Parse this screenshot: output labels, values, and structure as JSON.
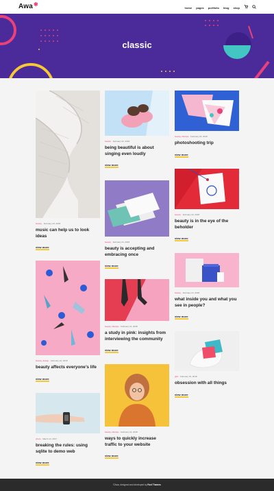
{
  "header": {
    "logo": "Awa",
    "nav": [
      "home",
      "pages",
      "portfolio",
      "blog",
      "shop"
    ],
    "cart_icon": "cart-icon",
    "search_icon": "search-icon"
  },
  "hero": {
    "title": "classic",
    "background": "#4b2a9a"
  },
  "accent": {
    "pink": "#e9427a",
    "yellow": "#f6c736"
  },
  "read_more": "view more",
  "posts": {
    "c1a": {
      "category": "beauty",
      "date": "February 23, 2018",
      "title": "music can help us to look ideas"
    },
    "c1b": {
      "category": "beauty, design",
      "date": "February 22, 2018",
      "title": "beauty affects everyone’s life"
    },
    "c1c": {
      "category": "photo",
      "date": "March 13, 2017",
      "title": "breaking the rules: using sqlite to demo web"
    },
    "c2a": {
      "category": "beauty",
      "date": "February 22, 2018",
      "title": "being beautiful is about singing even loudly"
    },
    "c2b": {
      "category": "beauty",
      "date": "February 21, 2018",
      "title": "beauty is accepting and embracing once"
    },
    "c2c": {
      "category": "beauty, lifestyle",
      "date": "February 21, 2018",
      "title": "a study in pink: insights from interviewing the community"
    },
    "c2d": {
      "category": "beauty, lifestyle",
      "date": "February 19, 2018",
      "title": "ways to quickly increase traffic to your website"
    },
    "c3a": {
      "category": "beauty, lifestyle",
      "date": "February 23, 2018",
      "title": "photoshooting trip"
    },
    "c3b": {
      "category": "beauty",
      "date": "February 22, 2018",
      "title": "beauty is in the eye of the beholder"
    },
    "c3c": {
      "category": "beauty",
      "date": "February 21, 2018",
      "title": "what inside you and what you see in people?"
    },
    "c3d": {
      "category": "glitz",
      "date": "February 19, 2018",
      "title": "obsession with all things"
    }
  },
  "footer": {
    "prefix": "©Awa, designed and developed by",
    "brand": "Foxl Themes"
  }
}
